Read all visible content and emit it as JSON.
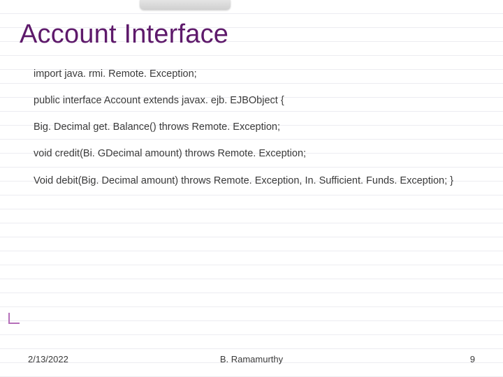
{
  "slide": {
    "title": "Account Interface",
    "lines": [
      "import java. rmi. Remote. Exception;",
      "public interface Account extends javax. ejb. EJBObject {",
      "Big. Decimal get. Balance() throws Remote. Exception;",
      "void credit(Bi. GDecimal amount) throws Remote. Exception;",
      "Void debit(Big. Decimal amount) throws Remote. Exception, In. Sufficient. Funds. Exception; }"
    ]
  },
  "footer": {
    "date": "2/13/2022",
    "author": "B. Ramamurthy",
    "page": "9"
  }
}
